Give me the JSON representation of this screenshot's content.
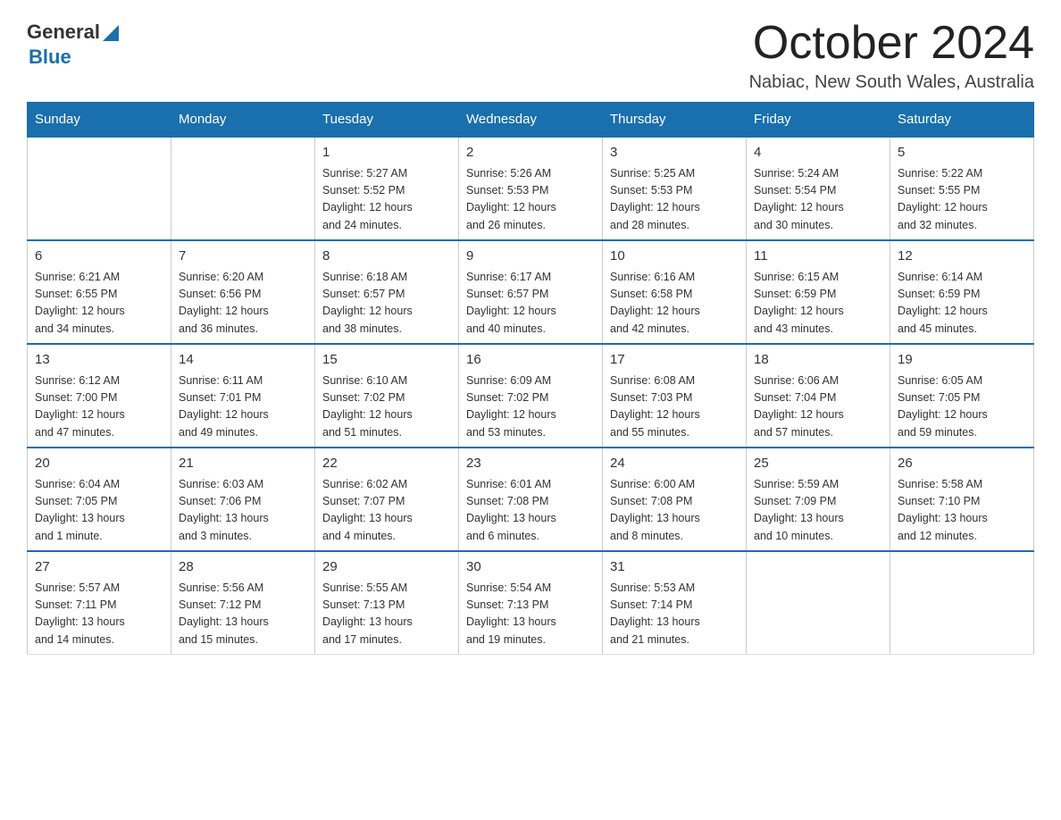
{
  "header": {
    "logo": {
      "general": "General",
      "arrow": "▲",
      "blue": "Blue"
    },
    "title": "October 2024",
    "subtitle": "Nabiac, New South Wales, Australia"
  },
  "calendar": {
    "weekdays": [
      "Sunday",
      "Monday",
      "Tuesday",
      "Wednesday",
      "Thursday",
      "Friday",
      "Saturday"
    ],
    "weeks": [
      [
        {
          "day": "",
          "info": ""
        },
        {
          "day": "",
          "info": ""
        },
        {
          "day": "1",
          "info": "Sunrise: 5:27 AM\nSunset: 5:52 PM\nDaylight: 12 hours\nand 24 minutes."
        },
        {
          "day": "2",
          "info": "Sunrise: 5:26 AM\nSunset: 5:53 PM\nDaylight: 12 hours\nand 26 minutes."
        },
        {
          "day": "3",
          "info": "Sunrise: 5:25 AM\nSunset: 5:53 PM\nDaylight: 12 hours\nand 28 minutes."
        },
        {
          "day": "4",
          "info": "Sunrise: 5:24 AM\nSunset: 5:54 PM\nDaylight: 12 hours\nand 30 minutes."
        },
        {
          "day": "5",
          "info": "Sunrise: 5:22 AM\nSunset: 5:55 PM\nDaylight: 12 hours\nand 32 minutes."
        }
      ],
      [
        {
          "day": "6",
          "info": "Sunrise: 6:21 AM\nSunset: 6:55 PM\nDaylight: 12 hours\nand 34 minutes."
        },
        {
          "day": "7",
          "info": "Sunrise: 6:20 AM\nSunset: 6:56 PM\nDaylight: 12 hours\nand 36 minutes."
        },
        {
          "day": "8",
          "info": "Sunrise: 6:18 AM\nSunset: 6:57 PM\nDaylight: 12 hours\nand 38 minutes."
        },
        {
          "day": "9",
          "info": "Sunrise: 6:17 AM\nSunset: 6:57 PM\nDaylight: 12 hours\nand 40 minutes."
        },
        {
          "day": "10",
          "info": "Sunrise: 6:16 AM\nSunset: 6:58 PM\nDaylight: 12 hours\nand 42 minutes."
        },
        {
          "day": "11",
          "info": "Sunrise: 6:15 AM\nSunset: 6:59 PM\nDaylight: 12 hours\nand 43 minutes."
        },
        {
          "day": "12",
          "info": "Sunrise: 6:14 AM\nSunset: 6:59 PM\nDaylight: 12 hours\nand 45 minutes."
        }
      ],
      [
        {
          "day": "13",
          "info": "Sunrise: 6:12 AM\nSunset: 7:00 PM\nDaylight: 12 hours\nand 47 minutes."
        },
        {
          "day": "14",
          "info": "Sunrise: 6:11 AM\nSunset: 7:01 PM\nDaylight: 12 hours\nand 49 minutes."
        },
        {
          "day": "15",
          "info": "Sunrise: 6:10 AM\nSunset: 7:02 PM\nDaylight: 12 hours\nand 51 minutes."
        },
        {
          "day": "16",
          "info": "Sunrise: 6:09 AM\nSunset: 7:02 PM\nDaylight: 12 hours\nand 53 minutes."
        },
        {
          "day": "17",
          "info": "Sunrise: 6:08 AM\nSunset: 7:03 PM\nDaylight: 12 hours\nand 55 minutes."
        },
        {
          "day": "18",
          "info": "Sunrise: 6:06 AM\nSunset: 7:04 PM\nDaylight: 12 hours\nand 57 minutes."
        },
        {
          "day": "19",
          "info": "Sunrise: 6:05 AM\nSunset: 7:05 PM\nDaylight: 12 hours\nand 59 minutes."
        }
      ],
      [
        {
          "day": "20",
          "info": "Sunrise: 6:04 AM\nSunset: 7:05 PM\nDaylight: 13 hours\nand 1 minute."
        },
        {
          "day": "21",
          "info": "Sunrise: 6:03 AM\nSunset: 7:06 PM\nDaylight: 13 hours\nand 3 minutes."
        },
        {
          "day": "22",
          "info": "Sunrise: 6:02 AM\nSunset: 7:07 PM\nDaylight: 13 hours\nand 4 minutes."
        },
        {
          "day": "23",
          "info": "Sunrise: 6:01 AM\nSunset: 7:08 PM\nDaylight: 13 hours\nand 6 minutes."
        },
        {
          "day": "24",
          "info": "Sunrise: 6:00 AM\nSunset: 7:08 PM\nDaylight: 13 hours\nand 8 minutes."
        },
        {
          "day": "25",
          "info": "Sunrise: 5:59 AM\nSunset: 7:09 PM\nDaylight: 13 hours\nand 10 minutes."
        },
        {
          "day": "26",
          "info": "Sunrise: 5:58 AM\nSunset: 7:10 PM\nDaylight: 13 hours\nand 12 minutes."
        }
      ],
      [
        {
          "day": "27",
          "info": "Sunrise: 5:57 AM\nSunset: 7:11 PM\nDaylight: 13 hours\nand 14 minutes."
        },
        {
          "day": "28",
          "info": "Sunrise: 5:56 AM\nSunset: 7:12 PM\nDaylight: 13 hours\nand 15 minutes."
        },
        {
          "day": "29",
          "info": "Sunrise: 5:55 AM\nSunset: 7:13 PM\nDaylight: 13 hours\nand 17 minutes."
        },
        {
          "day": "30",
          "info": "Sunrise: 5:54 AM\nSunset: 7:13 PM\nDaylight: 13 hours\nand 19 minutes."
        },
        {
          "day": "31",
          "info": "Sunrise: 5:53 AM\nSunset: 7:14 PM\nDaylight: 13 hours\nand 21 minutes."
        },
        {
          "day": "",
          "info": ""
        },
        {
          "day": "",
          "info": ""
        }
      ]
    ]
  }
}
